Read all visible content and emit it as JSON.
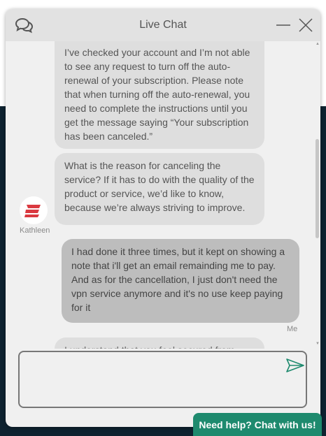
{
  "header": {
    "title": "Live Chat",
    "chat_icon": "chat-bubbles-icon",
    "minimize_icon": "minimize-icon",
    "close_icon": "close-icon"
  },
  "messages": [
    {
      "sender": "agent",
      "text": "I’ve checked your account and I’m not able to see any request to turn off the auto-renewal of your subscription. Please note that when turning off the auto-renewal, you need to complete the instructions until you get the message saying “Your subscription has been canceled.”"
    },
    {
      "sender": "agent",
      "text": "What is the reason for canceling the service? If it has to do with the quality of the product or service, we’d like to know, because we’re always striving to improve."
    },
    {
      "sender": "user",
      "text": "I had done it three times, but it kept on showing a note that i'll get an email remainding me to pay. And as for the cancellation, I just don't need the vpn service anymore and it's no use keep paying for it"
    },
    {
      "sender": "agent",
      "text": "I understand that you feel secured from VPN"
    }
  ],
  "agent": {
    "name": "Kathleen",
    "avatar_icon": "expressvpn-logo-icon",
    "logo_color": "#da3940"
  },
  "user": {
    "label": "Me"
  },
  "composer": {
    "placeholder": "",
    "send_icon": "send-icon"
  },
  "help_button": {
    "label": "Need help? Chat with us!",
    "color": "#1e8a6e"
  },
  "colors": {
    "page_dark": "#0e2230",
    "agent_bubble": "#dedede",
    "user_bubble": "#bdbdbd"
  }
}
